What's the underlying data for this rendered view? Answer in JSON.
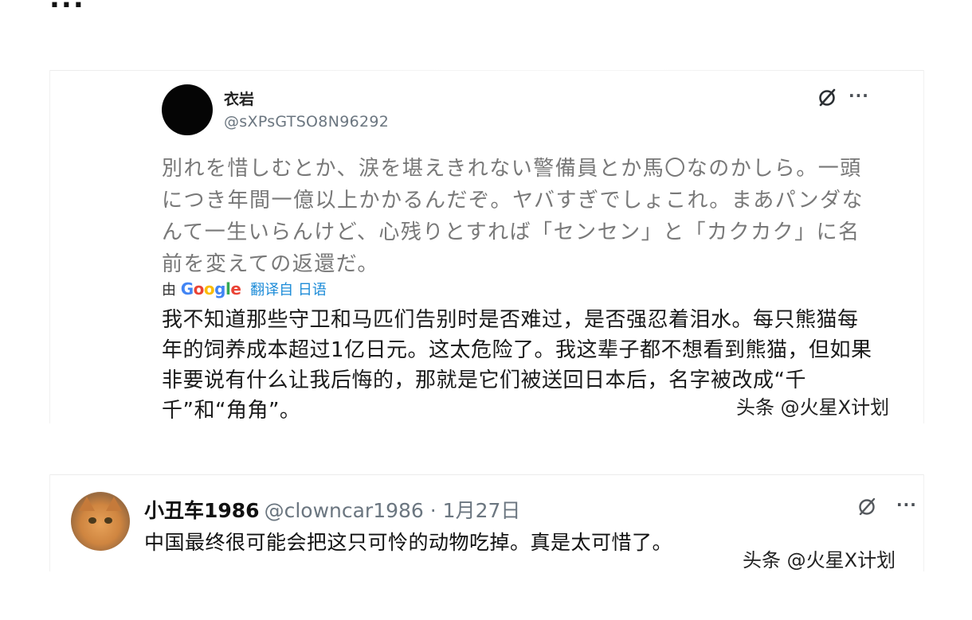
{
  "top_heading": "...",
  "tweet1": {
    "display_name": "衣岩",
    "handle": "@sXPsGTSO8N96292",
    "original_text": "別れを惜しむとか、涙を堪えきれない警備員とか馬〇なのかしら。一頭につき年間一億以上かかるんだぞ。ヤバすぎでしょこれ。まあパンダなんて一生いらんけど、心残りとすれば「センセン」と「カクカク」に名前を変えての返還だ。",
    "translate_prefix": "由",
    "translate_brand": "Google",
    "translate_link": "翻译自 日语",
    "translated_text": "我不知道那些守卫和马匹们告别时是否难过，是否强忍着泪水。每只熊猫每年的饲养成本超过1亿日元。这太危险了。我这辈子都不想看到熊猫，但如果非要说有什么让我后悔的，那就是它们被送回日本后，名字被改成“千千”和“角角”。",
    "grok_icon": "grok-slash-icon",
    "more_icon": "more-horizontal-icon",
    "more_label": "···"
  },
  "tweet2": {
    "display_name": "小丑车1986",
    "handle_and_date": "@clowncar1986 · 1月27日",
    "text": "中国最终很可能会把这只可怜的动物吃掉。真是太可惜了。",
    "grok_icon": "grok-slash-icon",
    "more_icon": "more-horizontal-icon",
    "more_label": "···"
  },
  "watermarks": {
    "first": "头条 @火星X计划",
    "second": "头条 @火星X计划"
  },
  "colors": {
    "handle_gray": "#6b7680",
    "link_blue": "#1d8cd8",
    "japanese_gray": "#787878"
  }
}
